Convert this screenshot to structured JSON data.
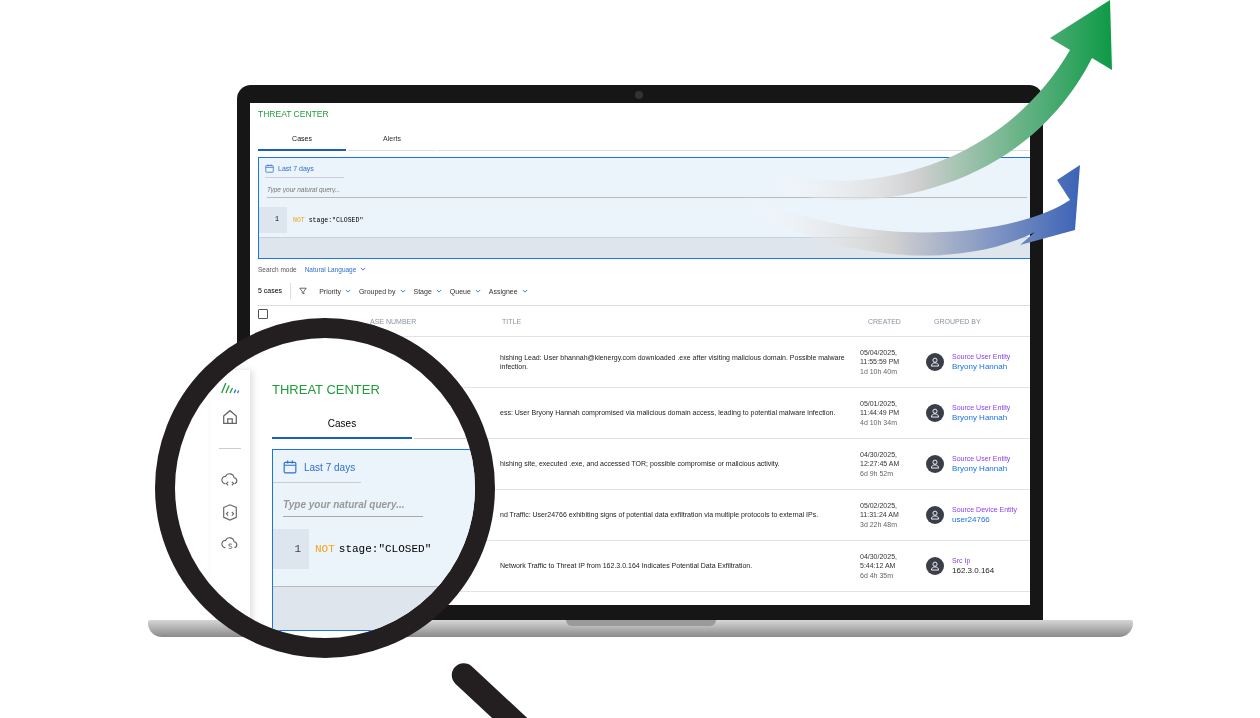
{
  "app_title": "THREAT CENTER",
  "tabs": [
    {
      "label": "Cases",
      "selected": true
    },
    {
      "label": "Alerts",
      "selected": false
    }
  ],
  "query": {
    "date_range": "Last 7 days",
    "placeholder": "Type your natural query...",
    "line_number": "1",
    "keyword": "NOT",
    "text": "stage:\"CLOSED\""
  },
  "search_mode": {
    "label": "Search mode",
    "value": "Natural Language"
  },
  "filters": {
    "count": "5 cases",
    "items": [
      "Priority",
      "Grouped by",
      "Stage",
      "Queue",
      "Assignee"
    ]
  },
  "table": {
    "select_all_checked": false,
    "columns": [
      "ASE NUMBER",
      "TITLE",
      "CREATED",
      "GROUPED BY"
    ],
    "rows": [
      {
        "title": "hishing Lead: User bhannah@klenergy.com downloaded .exe after visiting malicious domain. Possible malware infection.",
        "created": [
          "05/04/2025,",
          "11:55:59 PM",
          "1d 10h 40m"
        ],
        "group_label": "Source User Entity",
        "group_value": "Bryony Hannah",
        "kind": "link"
      },
      {
        "title": "ess: User Bryony Hannah compromised via malicious domain access, leading to potential malware infection.",
        "created": [
          "05/01/2025,",
          "11:44:49 PM",
          "4d 10h 34m"
        ],
        "group_label": "Source User Entity",
        "group_value": "Bryony Hannah",
        "kind": "link"
      },
      {
        "title": "hishing site, executed .exe, and accessed TOR; possible compromise or malicious activity.",
        "created": [
          "04/30/2025,",
          "12:27:45 AM",
          "6d 9h 52m"
        ],
        "group_label": "Source User Entity",
        "group_value": "Bryony Hannah",
        "kind": "link"
      },
      {
        "title": "nd Traffic: User24766 exhibiting signs of potential data exfiltration via multiple protocols to external IPs.",
        "created": [
          "05/02/2025,",
          "11:31:24 AM",
          "3d 22h 48m"
        ],
        "group_label": "Source Device Entity",
        "group_value": "user24766",
        "kind": "link"
      },
      {
        "title": "Network Traffic to Threat IP from 162.3.0.164 Indicates Potential Data Exfiltration.",
        "created": [
          "04/30/2025,",
          "5:44:12 AM",
          "6d 4h 35m"
        ],
        "group_label": "Src Ip",
        "group_value": "162.3.0.164",
        "kind": "text"
      }
    ]
  },
  "magnifier": {
    "app_title": "THREAT CENTER",
    "tab": "Cases",
    "date_range": "Last 7 days",
    "placeholder": "Type your natural query...",
    "line_number": "1",
    "keyword": "NOT",
    "text": "stage:\"CLOSED\""
  }
}
